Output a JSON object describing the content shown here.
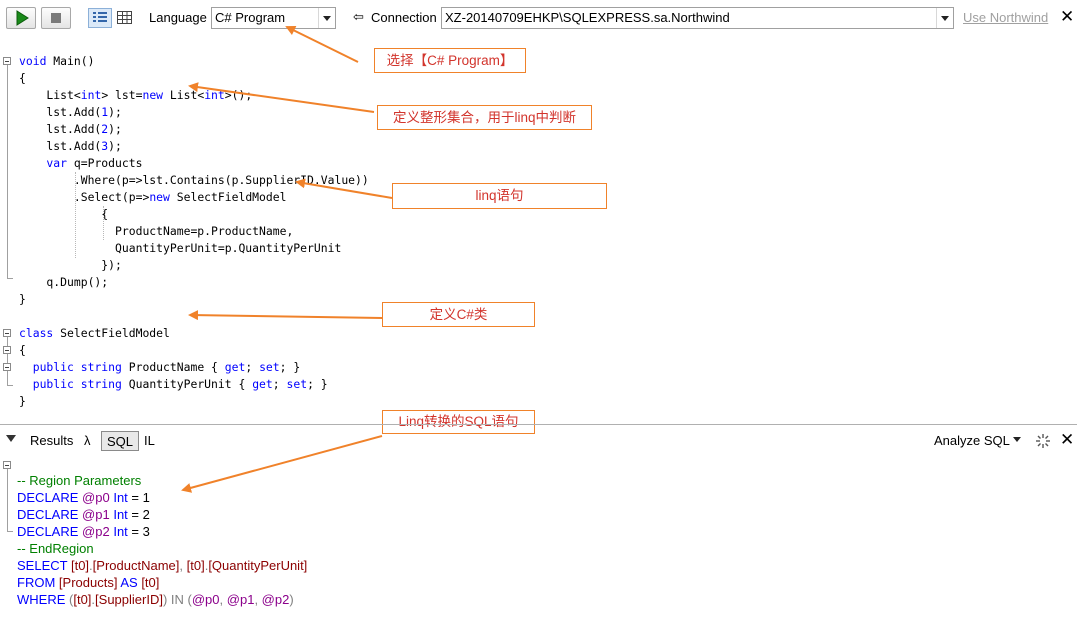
{
  "toolbar": {
    "language_label": "Language",
    "language_value": "C# Program",
    "connection_arrow": "⇦",
    "connection_label": "Connection",
    "connection_value": "XZ-20140709EHKP\\SQLEXPRESS.sa.Northwind",
    "use_db_link": "Use Northwind",
    "close_glyph": "✕",
    "icons": [
      "run-icon",
      "stop-icon",
      "grid-results-icon",
      "table-results-icon"
    ]
  },
  "code": {
    "lines": {
      "l1a": "void",
      "l1b": " Main()",
      "l2": "{",
      "l3a": "    List<",
      "l3b": "int",
      "l3c": "> lst=",
      "l3d": "new",
      "l3e": " List<",
      "l3f": "int",
      "l3g": ">();",
      "l4a": "    lst.Add(",
      "l4b": "1",
      "l4c": ");",
      "l5a": "    lst.Add(",
      "l5b": "2",
      "l5c": ");",
      "l6a": "    lst.Add(",
      "l6b": "3",
      "l6c": ");",
      "l7a": "    var",
      "l7b": " q=Products",
      "l8": "        .Where(p=>lst.Contains(p.SupplierID.Value))",
      "l9a": "        .Select(p=>",
      "l9b": "new",
      "l9c": " SelectFieldModel",
      "l10": "            {",
      "l11": "              ProductName=p.ProductName,",
      "l12": "              QuantityPerUnit=p.QuantityPerUnit",
      "l13": "            });",
      "l14": "    q.Dump();",
      "l15": "}",
      "l17a": "class",
      "l17b": " SelectFieldModel",
      "l18": "{",
      "l19a": "  public",
      "l19b": " string",
      "l19c": " ProductName { ",
      "l19d": "get",
      "l19e": "; ",
      "l19f": "set",
      "l19g": "; }",
      "l20a": "  public",
      "l20b": " string",
      "l20c": " QuantityPerUnit { ",
      "l20d": "get",
      "l20e": "; ",
      "l20f": "set",
      "l20g": "; }",
      "l21": "}"
    }
  },
  "annotations": {
    "a1": "选择【C# Program】",
    "a2": "定义整形集合，用于linq中判断",
    "a3": "linq语句",
    "a4": "定义C#类",
    "a5": "Linq转换的SQL语句"
  },
  "results_bar": {
    "results_tab": "Results",
    "lambda_tab": "λ",
    "sql_tab": "SQL",
    "il_tab": "IL",
    "analyze_label": "Analyze SQL",
    "close_glyph": "✕"
  },
  "sql_output": {
    "r1": "-- Region Parameters",
    "r2a": "DECLARE",
    "r2b": "@p0",
    "r2c": "Int",
    "r2d": " = 1",
    "r3a": "DECLARE",
    "r3b": "@p1",
    "r3c": "Int",
    "r3d": " = 2",
    "r4a": "DECLARE",
    "r4b": "@p2",
    "r4c": "Int",
    "r4d": " = 3",
    "r5": "-- EndRegion",
    "r6a": "SELECT",
    "r6b": "[t0]",
    "r6c": ".",
    "r6d": "[ProductName]",
    "r6e": ", ",
    "r6f": "[t0]",
    "r6g": ".",
    "r6h": "[QuantityPerUnit]",
    "r7a": "FROM",
    "r7b": "[Products]",
    "r7c": "AS",
    "r7d": "[t0]",
    "r8a": "WHERE",
    "r8b": " (",
    "r8c": "[t0]",
    "r8d": ".",
    "r8e": "[SupplierID]",
    "r8f": ") IN (",
    "r8g": "@p0",
    "r8h": ", ",
    "r8i": "@p1",
    "r8j": ", ",
    "r8k": "@p2",
    "r8l": ")"
  },
  "colors": {
    "annotation_border": "#f0822a",
    "annotation_text": "#d2342c",
    "keyword": "#0000ff",
    "comment": "#008000"
  }
}
